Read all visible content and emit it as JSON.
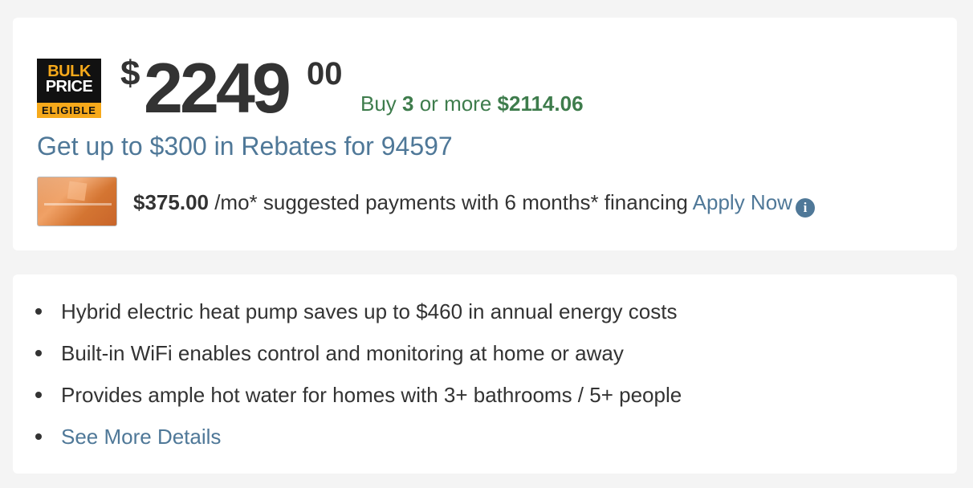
{
  "badge": {
    "line1": "BULK",
    "line2": "PRICE",
    "eligible": "ELIGIBLE"
  },
  "price": {
    "currency_symbol": "$",
    "dollars": "2249",
    "cents": "00"
  },
  "bulk_offer": {
    "prefix": "Buy ",
    "quantity": "3",
    "middle": " or more ",
    "price": "$2114.06"
  },
  "rebate_link": "Get up to $300 in Rebates for 94597",
  "financing": {
    "amount": "$375.00",
    "text": " /mo* suggested payments with 6 months* financing ",
    "apply_label": "Apply Now"
  },
  "info_icon": "i",
  "features": [
    "Hybrid electric heat pump saves up to $460 in annual energy costs",
    "Built-in WiFi enables control and monitoring at home or away",
    "Provides ample hot water for homes with 3+ bathrooms / 5+ people"
  ],
  "see_more_label": "See More Details",
  "colors": {
    "background": "#f4f4f4",
    "card": "#ffffff",
    "link": "#4f7898",
    "bulk_green": "#3e7c4c",
    "badge_orange": "#f6a91b",
    "text": "#333333"
  }
}
